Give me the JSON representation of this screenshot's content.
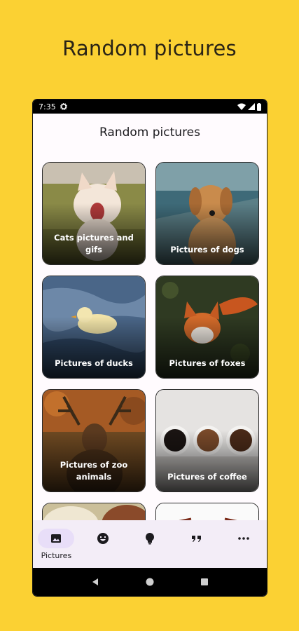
{
  "promo": {
    "title": "Random pictures"
  },
  "status_bar": {
    "time": "7:35"
  },
  "app": {
    "title": "Random pictures"
  },
  "cards": [
    {
      "label": "Cats pictures and gifs",
      "subject": "cat"
    },
    {
      "label": "Pictures of dogs",
      "subject": "dog"
    },
    {
      "label": "Pictures of ducks",
      "subject": "duck"
    },
    {
      "label": "Pictures of foxes",
      "subject": "fox"
    },
    {
      "label": "Pictures of zoo animals",
      "subject": "deer"
    },
    {
      "label": "Pictures of coffee",
      "subject": "coffee"
    }
  ],
  "bottom_nav": {
    "items": [
      {
        "label": "Pictures",
        "icon": "image-icon",
        "active": true
      },
      {
        "label": "",
        "icon": "emoji-icon",
        "active": false
      },
      {
        "label": "",
        "icon": "lightbulb-icon",
        "active": false
      },
      {
        "label": "",
        "icon": "quote-icon",
        "active": false
      },
      {
        "label": "",
        "icon": "more-icon",
        "active": false
      }
    ]
  },
  "colors": {
    "background": "#FBD133",
    "nav_active": "#E8DEF8",
    "nav_bar": "#F3EDF7"
  }
}
